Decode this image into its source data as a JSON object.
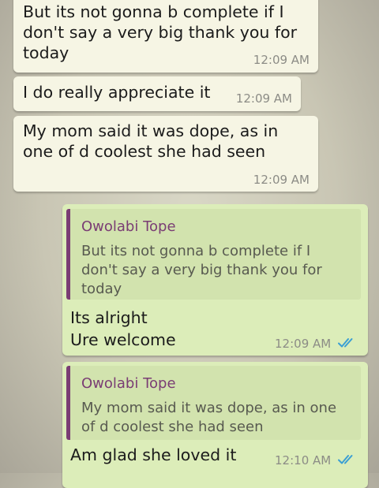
{
  "messages": [
    {
      "text": "But its not gonna b complete if I\ndon't say a very big thank you for\ntoday",
      "time": "12:09 AM"
    },
    {
      "text": "I do really appreciate it",
      "time": "12:09 AM"
    },
    {
      "text": "My mom said it was dope, as in\none of d coolest she had seen",
      "time": "12:09 AM"
    },
    {
      "quote_author": "Owolabi Tope",
      "quote_text": "But its not gonna b complete if I\ndon't say a very big thank you for\ntoday",
      "text": "Its alright\nUre welcome",
      "time": "12:09 AM"
    },
    {
      "quote_author": "Owolabi Tope",
      "quote_text": "My mom said it was dope, as in one\nof d coolest she had seen",
      "text": "Am glad she loved it",
      "time": "12:10 AM"
    }
  ],
  "colors": {
    "incoming_bubble": "#f6f5e4",
    "outgoing_bubble": "#dcedb9",
    "quote_accent": "#7a3d74",
    "read_ticks": "#3b9fd4"
  },
  "icons": {
    "read_receipt": "double-check-icon"
  }
}
